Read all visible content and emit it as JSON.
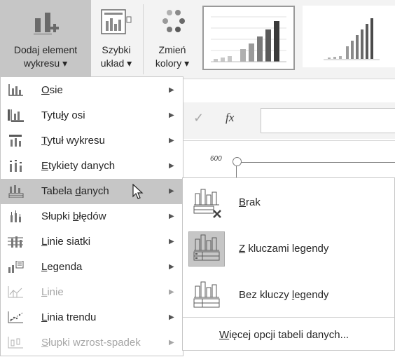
{
  "ribbon": {
    "add_element": {
      "line1": "Dodaj element",
      "line2": "wykresu ▾"
    },
    "quick_layout": {
      "line1": "Szybki",
      "line2": "układ ▾"
    },
    "change_colors": {
      "line1": "Zmień",
      "line2": "kolory ▾"
    }
  },
  "formula_bar": {
    "fx": "fx"
  },
  "chart": {
    "tick_600": "600"
  },
  "menu": {
    "items": [
      {
        "pre": "",
        "u": "O",
        "post": "sie",
        "icon": "axes-icon",
        "disabled": false
      },
      {
        "pre": "Tytu",
        "u": "ł",
        "post": "y osi",
        "icon": "axis-titles-icon",
        "disabled": false
      },
      {
        "pre": "",
        "u": "T",
        "post": "ytuł wykresu",
        "icon": "chart-title-icon",
        "disabled": false
      },
      {
        "pre": "",
        "u": "E",
        "post": "tykiety danych",
        "icon": "data-labels-icon",
        "disabled": false
      },
      {
        "pre": "Tabela ",
        "u": "d",
        "post": "anych",
        "icon": "data-table-icon",
        "disabled": false
      },
      {
        "pre": "Słupki ",
        "u": "b",
        "post": "łędów",
        "icon": "error-bars-icon",
        "disabled": false
      },
      {
        "pre": "",
        "u": "L",
        "post": "inie siatki",
        "icon": "gridlines-icon",
        "disabled": false
      },
      {
        "pre": "",
        "u": "L",
        "post": "egenda",
        "icon": "legend-icon",
        "disabled": false
      },
      {
        "pre": "",
        "u": "L",
        "post": "inie",
        "icon": "lines-icon",
        "disabled": true
      },
      {
        "pre": "",
        "u": "L",
        "post": "inia trendu",
        "icon": "trendline-icon",
        "disabled": false
      },
      {
        "pre": "",
        "u": "S",
        "post": "łupki wzrost-spadek",
        "icon": "updown-bars-icon",
        "disabled": true
      }
    ]
  },
  "submenu": {
    "items": [
      {
        "pre": "",
        "u": "B",
        "post": "rak"
      },
      {
        "pre": "",
        "u": "Z",
        "post": " kluczami legendy"
      },
      {
        "pre": "Bez kluczy ",
        "u": "l",
        "post": "egendy"
      }
    ],
    "more": {
      "pre": "",
      "u": "W",
      "post": "ięcej opcji tabeli danych..."
    }
  },
  "colors": {
    "highlight": "#c6c6c6",
    "ribbon_bg": "#f3f3f3"
  }
}
